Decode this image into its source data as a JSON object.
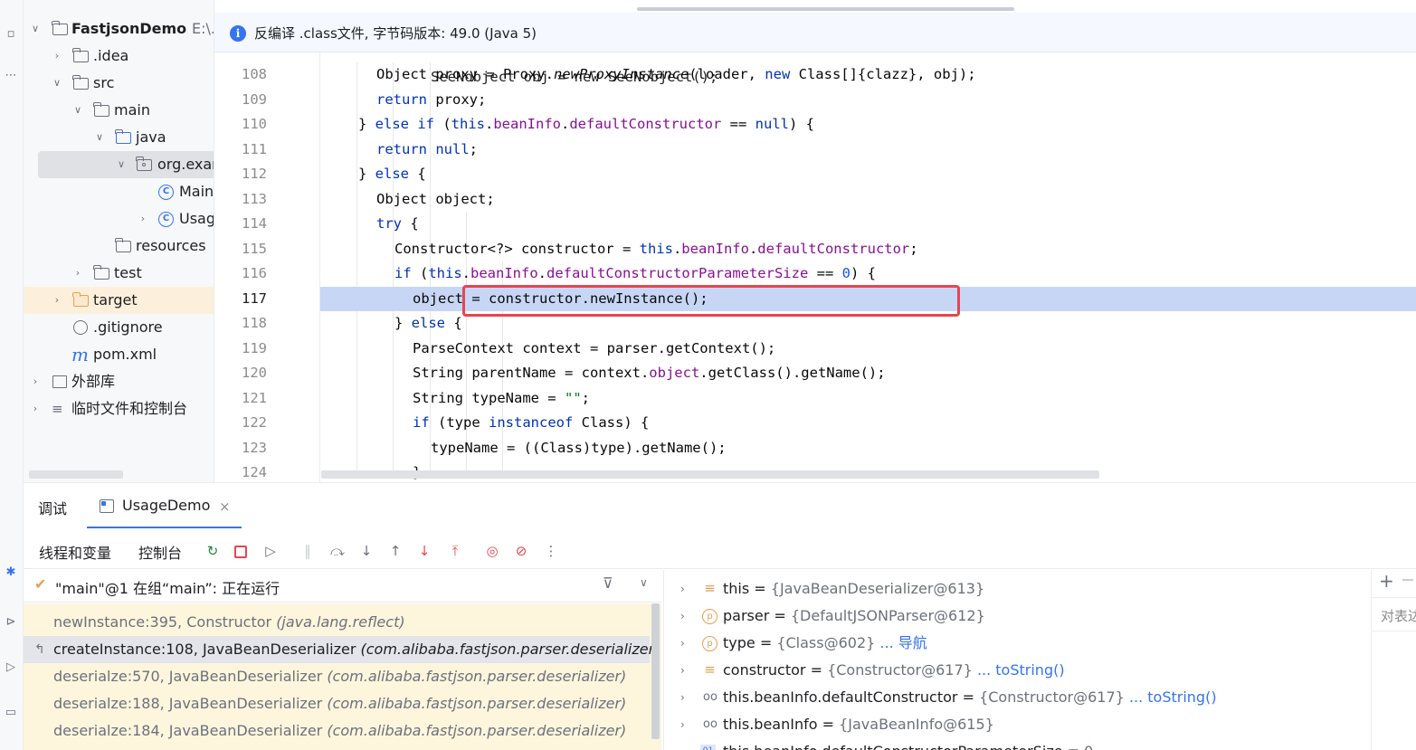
{
  "project": {
    "root_name": "FastjsonDemo",
    "root_path": "E:\\...",
    "items": [
      {
        "label": ".idea"
      },
      {
        "label": "src"
      },
      {
        "label": "main"
      },
      {
        "label": "java"
      },
      {
        "label": "org.exar"
      },
      {
        "label": "Main"
      },
      {
        "label": "Usag"
      },
      {
        "label": "resources"
      },
      {
        "label": "test"
      },
      {
        "label": "target"
      },
      {
        "label": ".gitignore"
      },
      {
        "label": "pom.xml"
      },
      {
        "label": "外部库"
      },
      {
        "label": "临时文件和控制台"
      }
    ]
  },
  "editor": {
    "banner": "反编译 .class文件, 字节码版本: 49.0 (Java 5)",
    "partial_line": "SeeNobject obj = new SeeNobject();",
    "lines": [
      {
        "n": "108",
        "parts": [
          {
            "t": "Object proxy = Proxy."
          },
          {
            "t": "newProxyInstance",
            "c": "it"
          },
          {
            "t": "(loader, "
          },
          {
            "t": "new",
            "c": "kw"
          },
          {
            "t": " Class[]{clazz}, obj);"
          }
        ]
      },
      {
        "n": "109",
        "parts": [
          {
            "t": "return",
            "c": "kw"
          },
          {
            "t": " proxy;"
          }
        ]
      },
      {
        "n": "110",
        "parts": [
          {
            "t": "} "
          },
          {
            "t": "else if",
            "c": "kw"
          },
          {
            "t": " ("
          },
          {
            "t": "this",
            "c": "kw"
          },
          {
            "t": "."
          },
          {
            "t": "beanInfo",
            "c": "fld"
          },
          {
            "t": "."
          },
          {
            "t": "defaultConstructor",
            "c": "fld"
          },
          {
            "t": " == "
          },
          {
            "t": "null",
            "c": "kw"
          },
          {
            "t": ") {"
          }
        ]
      },
      {
        "n": "111",
        "parts": [
          {
            "t": "return",
            "c": "kw"
          },
          {
            "t": " "
          },
          {
            "t": "null",
            "c": "kw"
          },
          {
            "t": ";"
          }
        ]
      },
      {
        "n": "112",
        "parts": [
          {
            "t": "} "
          },
          {
            "t": "else",
            "c": "kw"
          },
          {
            "t": " {"
          }
        ]
      },
      {
        "n": "113",
        "parts": [
          {
            "t": "Object object;"
          }
        ]
      },
      {
        "n": "114",
        "parts": [
          {
            "t": "try",
            "c": "kw"
          },
          {
            "t": " {"
          }
        ]
      },
      {
        "n": "115",
        "parts": [
          {
            "t": "Constructor<?> constructor = "
          },
          {
            "t": "this",
            "c": "kw"
          },
          {
            "t": "."
          },
          {
            "t": "beanInfo",
            "c": "fld"
          },
          {
            "t": "."
          },
          {
            "t": "defaultConstructor",
            "c": "fld"
          },
          {
            "t": ";"
          }
        ]
      },
      {
        "n": "116",
        "parts": [
          {
            "t": "if",
            "c": "kw"
          },
          {
            "t": " ("
          },
          {
            "t": "this",
            "c": "kw"
          },
          {
            "t": "."
          },
          {
            "t": "beanInfo",
            "c": "fld"
          },
          {
            "t": "."
          },
          {
            "t": "defaultConstructorParameterSize",
            "c": "fld"
          },
          {
            "t": " == "
          },
          {
            "t": "0",
            "c": "num"
          },
          {
            "t": ") {"
          }
        ]
      },
      {
        "n": "117",
        "parts": [
          {
            "t": "object = constructor.newInstance();"
          }
        ]
      },
      {
        "n": "118",
        "parts": [
          {
            "t": "} "
          },
          {
            "t": "else",
            "c": "kw"
          },
          {
            "t": " {"
          }
        ]
      },
      {
        "n": "119",
        "parts": [
          {
            "t": "ParseContext context = parser.getContext();"
          }
        ]
      },
      {
        "n": "120",
        "parts": [
          {
            "t": "String parentName = context."
          },
          {
            "t": "object",
            "c": "fld"
          },
          {
            "t": ".getClass().getName();"
          }
        ]
      },
      {
        "n": "121",
        "parts": [
          {
            "t": "String typeName = "
          },
          {
            "t": "\"\"",
            "c": "str"
          },
          {
            "t": ";"
          }
        ]
      },
      {
        "n": "122",
        "parts": [
          {
            "t": "if",
            "c": "kw"
          },
          {
            "t": " (type "
          },
          {
            "t": "instanceof",
            "c": "kw"
          },
          {
            "t": " Class) {"
          }
        ]
      },
      {
        "n": "123",
        "parts": [
          {
            "t": "typeName = ((Class)type).getName();"
          }
        ]
      },
      {
        "n": "124",
        "parts": [
          {
            "t": "}"
          }
        ]
      }
    ]
  },
  "debug": {
    "tab_debug": "调试",
    "tab_session": "UsageDemo",
    "tab_threads": "线程和变量",
    "tab_console": "控制台",
    "thread_status": "\"main\"@1 在组“main”: 正在运行",
    "frames": [
      {
        "method": "newInstance:395, Constructor ",
        "pkg": "(java.lang.reflect)"
      },
      {
        "method": "createInstance:108, JavaBeanDeserializer ",
        "pkg": "(com.alibaba.fastjson.parser.deserializer)"
      },
      {
        "method": "deserialze:570, JavaBeanDeserializer ",
        "pkg": "(com.alibaba.fastjson.parser.deserializer)"
      },
      {
        "method": "deserialze:188, JavaBeanDeserializer ",
        "pkg": "(com.alibaba.fastjson.parser.deserializer)"
      },
      {
        "method": "deserialze:184, JavaBeanDeserializer ",
        "pkg": "(com.alibaba.fastjson.parser.deserializer)"
      }
    ],
    "variables": [
      {
        "name": "this",
        "value": "{JavaBeanDeserializer@613}",
        "link": ""
      },
      {
        "name": "parser",
        "value": "{DefaultJSONParser@612}",
        "link": ""
      },
      {
        "name": "type",
        "value": "{Class@602}",
        "link": "... 导航"
      },
      {
        "name": "constructor",
        "value": "{Constructor@617}",
        "link": "... toString()"
      },
      {
        "name": "this.beanInfo.defaultConstructor",
        "value": "{Constructor@617}",
        "link": "... toString()"
      },
      {
        "name": "this.beanInfo",
        "value": "{JavaBeanInfo@615}",
        "link": ""
      },
      {
        "name": "this.beanInfo.defaultConstructorParameterSize",
        "value": "0",
        "link": ""
      }
    ],
    "right_pane_label": "对表达",
    "right_pane_plus": "+"
  }
}
